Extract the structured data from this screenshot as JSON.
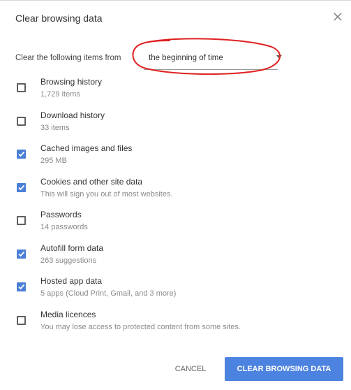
{
  "dialog": {
    "title": "Clear browsing data",
    "close_icon": "close-icon"
  },
  "time_range": {
    "label": "Clear the following items from",
    "value": "the beginning of time"
  },
  "items": [
    {
      "label": "Browsing history",
      "sub": "1,729 items",
      "checked": false
    },
    {
      "label": "Download history",
      "sub": "33 items",
      "checked": false
    },
    {
      "label": "Cached images and files",
      "sub": "295 MB",
      "checked": true
    },
    {
      "label": "Cookies and other site data",
      "sub": "This will sign you out of most websites.",
      "checked": true
    },
    {
      "label": "Passwords",
      "sub": "14 passwords",
      "checked": false
    },
    {
      "label": "Autofill form data",
      "sub": "263 suggestions",
      "checked": true
    },
    {
      "label": "Hosted app data",
      "sub": "5 apps (Cloud Print, Gmail, and 3 more)",
      "checked": true
    },
    {
      "label": "Media licences",
      "sub": "You may lose access to protected content from some sites.",
      "checked": false
    }
  ],
  "buttons": {
    "cancel": "CANCEL",
    "clear": "CLEAR BROWSING DATA"
  },
  "colors": {
    "accent": "#4d83e0",
    "checkbox_checked": "#4a7fd6",
    "annotation": "#e02020"
  }
}
